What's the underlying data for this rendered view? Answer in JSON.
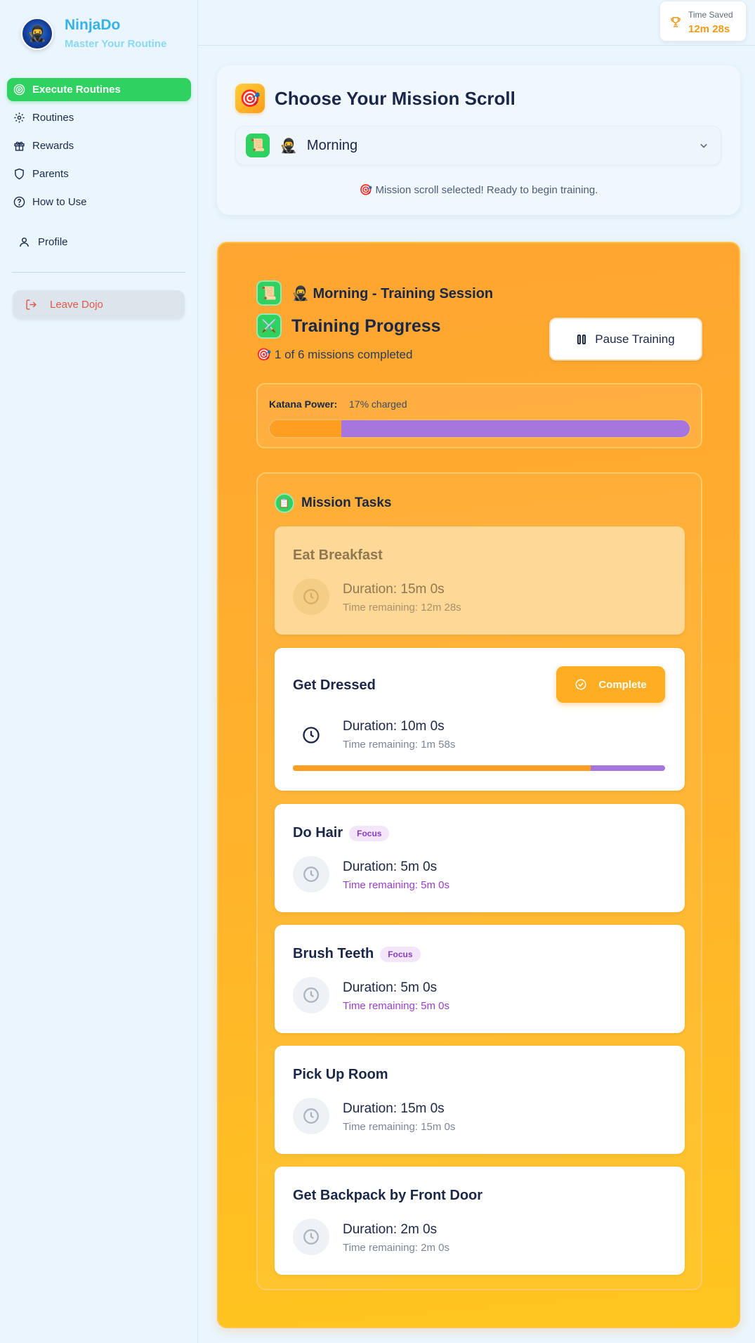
{
  "brand": {
    "name": "NinjaDo",
    "tagline": "Master Your Routine"
  },
  "nav": {
    "items": [
      {
        "label": "Execute Routines",
        "icon": "target-icon",
        "active": true
      },
      {
        "label": "Routines",
        "icon": "gear-icon",
        "active": false
      },
      {
        "label": "Rewards",
        "icon": "gift-icon",
        "active": false
      },
      {
        "label": "Parents",
        "icon": "shield-icon",
        "active": false
      },
      {
        "label": "How to Use",
        "icon": "help-icon",
        "active": false
      }
    ],
    "profile_label": "Profile",
    "leave_label": "Leave Dojo"
  },
  "header": {
    "time_saved_label": "Time Saved",
    "time_saved_value": "12m 28s"
  },
  "scroll": {
    "title": "Choose Your Mission Scroll",
    "selected": "Morning",
    "status": "🎯 Mission scroll selected! Ready to begin training."
  },
  "session": {
    "title": "🥷 Morning - Training Session",
    "progress_title": "Training Progress",
    "progress_sub": "🎯 1 of 6 missions completed",
    "pause_label": "Pause Training",
    "katana_label": "Katana Power:",
    "katana_value": "17% charged",
    "katana_fraction": 0.17
  },
  "tasks_section": {
    "title": "Mission Tasks",
    "complete_label": "Complete",
    "tasks": [
      {
        "name": "Eat Breakfast",
        "duration": "Duration: 15m 0s",
        "remaining": "Time remaining: 12m 28s",
        "state": "done",
        "badge": ""
      },
      {
        "name": "Get Dressed",
        "duration": "Duration: 10m 0s",
        "remaining": "Time remaining: 1m 58s",
        "state": "active",
        "badge": "",
        "progress_fraction": 0.8
      },
      {
        "name": "Do Hair",
        "duration": "Duration: 5m 0s",
        "remaining": "Time remaining: 5m 0s",
        "state": "pending",
        "badge": "Focus"
      },
      {
        "name": "Brush Teeth",
        "duration": "Duration: 5m 0s",
        "remaining": "Time remaining: 5m 0s",
        "state": "pending",
        "badge": "Focus"
      },
      {
        "name": "Pick Up Room",
        "duration": "Duration: 15m 0s",
        "remaining": "Time remaining: 15m 0s",
        "state": "pending",
        "badge": ""
      },
      {
        "name": "Get Backpack by Front Door",
        "duration": "Duration: 2m 0s",
        "remaining": "Time remaining: 2m 0s",
        "state": "pending",
        "badge": ""
      }
    ]
  },
  "colors": {
    "accent_green": "#2fd160",
    "accent_orange": "#ffa531",
    "progress_purple": "#a676de",
    "danger": "#e0584a"
  }
}
